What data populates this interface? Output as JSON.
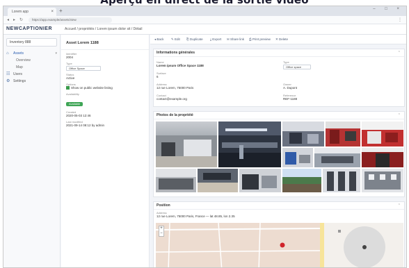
{
  "banner": {
    "text": "Aperçu en direct de la sortie vidéo"
  },
  "browser": {
    "tab_label": "Lorem app",
    "tab_close": "×",
    "new_tab": "+",
    "window_controls": "– □ ×",
    "url": "https://app.example/assets/view",
    "url_menu": "⋮"
  },
  "app": {
    "logo": "NEWCAPTIONIER",
    "breadcrumb": "Accueil / propriétés / Lorem ipsum dolor sit / Détail"
  },
  "sidebar": {
    "top_button": "Inventory 888",
    "items": [
      {
        "label": "Assets",
        "icon": "home-icon",
        "active": true
      },
      {
        "label": "Overview",
        "sub": true
      },
      {
        "label": "Map",
        "sub": true
      },
      {
        "label": "Users",
        "icon": "users-icon"
      },
      {
        "label": "Settings",
        "icon": "gear-icon"
      }
    ]
  },
  "info": {
    "title": "Asset Lorem 1188",
    "fields": [
      {
        "label": "Identifier",
        "value": "2004"
      },
      {
        "label": "Type",
        "value": "Office Space"
      },
      {
        "label": "Status",
        "value": "Active"
      },
      {
        "label": "Options",
        "value": "Show on public website listing"
      },
      {
        "label": "Availability",
        "value": "Available"
      },
      {
        "label": "Created",
        "value": "2020-05-03 12:46"
      },
      {
        "label": "Last modified",
        "value": "2021-09-14 08:12 by admin"
      }
    ]
  },
  "toolbar": {
    "buttons": [
      "◂ Back",
      "✎ Edit",
      "⎘ Duplicate",
      "⤓ Export",
      "✉ Share link",
      "⎙ Print preview",
      "✕ Delete"
    ]
  },
  "general": {
    "title": "Informations générales",
    "name_label": "Name",
    "name_value": "Lorem ipsum Office Space 1188",
    "type_label": "Type",
    "type_value": "Office space",
    "surface_label": "Surface",
    "surface_value": "6",
    "address_label": "Address",
    "address_value": "12 rue Lorem, 75000 Paris",
    "owner_label": "Owner",
    "owner_value": "A. Dupont",
    "contact_label": "Contact",
    "contact_value": "contact@example.org",
    "ref_label": "Reference",
    "ref_value": "REF-1188"
  },
  "photos": {
    "title": "Photos de la propriété",
    "count": 14
  },
  "location": {
    "title": "Position",
    "address_label": "Address",
    "address_value": "12 rue Lorem, 75000 Paris, France — lat 48.85, lon 2.35",
    "zoom_in": "+",
    "zoom_out": "−"
  },
  "colors": {
    "accent": "#2a5db0",
    "map_bg": "#e8dcd0",
    "pin": "#d0232a"
  }
}
